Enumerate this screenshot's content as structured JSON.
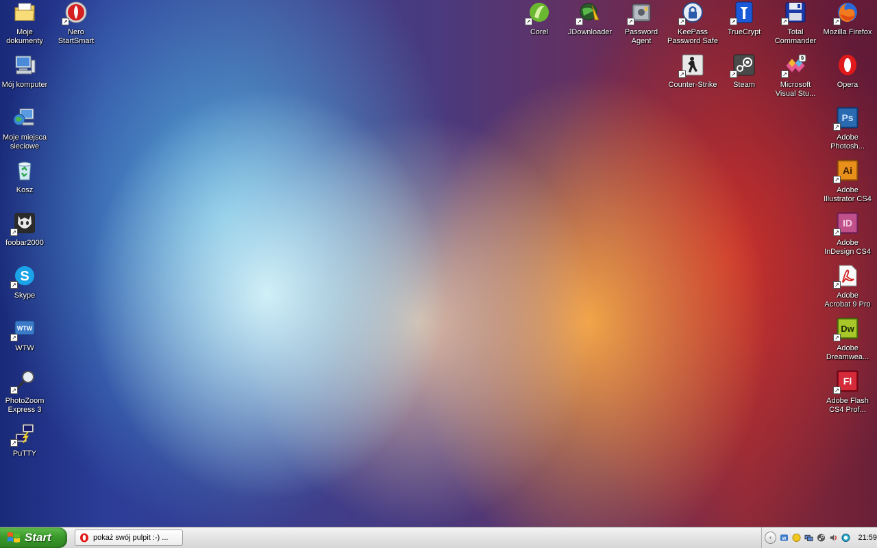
{
  "desktop": {
    "icons": [
      {
        "label": "Moje\ndokumenty",
        "icon": "documents-folder-icon"
      },
      {
        "label": "Nero\nStartSmart",
        "icon": "nero-icon"
      },
      {
        "label": "Mój komputer",
        "icon": "computer-icon"
      },
      {
        "label": "Moje miejsca\nsieciowe",
        "icon": "network-places-icon"
      },
      {
        "label": "Kosz",
        "icon": "recycle-bin-icon"
      },
      {
        "label": "foobar2000",
        "icon": "foobar2000-icon"
      },
      {
        "label": "Skype",
        "icon": "skype-icon"
      },
      {
        "label": "WTW",
        "icon": "wtw-icon"
      },
      {
        "label": "PhotoZoom\nExpress 3",
        "icon": "photozoom-icon"
      },
      {
        "label": "PuTTY",
        "icon": "putty-icon"
      },
      {
        "label": "Corel",
        "icon": "corel-icon"
      },
      {
        "label": "JDownloader",
        "icon": "jdownloader-icon"
      },
      {
        "label": "Password\nAgent",
        "icon": "password-agent-icon"
      },
      {
        "label": "KeePass\nPassword Safe",
        "icon": "keepass-icon"
      },
      {
        "label": "TrueCrypt",
        "icon": "truecrypt-icon"
      },
      {
        "label": "Total\nCommander",
        "icon": "total-commander-icon"
      },
      {
        "label": "Mozilla Firefox",
        "icon": "firefox-icon"
      },
      {
        "label": "Counter-Strike",
        "icon": "counter-strike-icon"
      },
      {
        "label": "Steam",
        "icon": "steam-icon"
      },
      {
        "label": "Microsoft\nVisual Stu...",
        "icon": "visual-studio-icon"
      },
      {
        "label": "Opera",
        "icon": "opera-icon"
      },
      {
        "label": "Adobe\nPhotosh...",
        "icon": "photoshop-icon"
      },
      {
        "label": "Adobe\nIllustrator CS4",
        "icon": "illustrator-icon"
      },
      {
        "label": "Adobe\nInDesign CS4",
        "icon": "indesign-icon"
      },
      {
        "label": "Adobe\nAcrobat 9 Pro",
        "icon": "acrobat-icon"
      },
      {
        "label": "Adobe\nDreamwea...",
        "icon": "dreamweaver-icon"
      },
      {
        "label": "Adobe Flash\nCS4 Prof...",
        "icon": "flash-icon"
      }
    ],
    "icon_texts": {
      "photoshop": "Ps",
      "illustrator": "Ai",
      "indesign": "ID",
      "dreamweaver": "Dw",
      "flash": "Fl",
      "wtw": "WTW",
      "visual_studio_badge": "9"
    }
  },
  "taskbar": {
    "start_label": "Start",
    "tasks": [
      {
        "label": "pokaż swój pulpit :-) ...",
        "icon": "opera-icon"
      }
    ],
    "tray": {
      "icons": [
        "tray-chevron-icon",
        "wtw-tray-icon",
        "messenger-tray-icon",
        "network-tray-icon",
        "steam-tray-icon",
        "volume-tray-icon",
        "update-tray-icon"
      ],
      "clock": "21:59"
    }
  },
  "colors": {
    "start_green": "#3b9a2c",
    "taskbar_grey": "#e6e6e6",
    "desktop_blue": "#2c3d98",
    "desktop_orange": "#f8aa46",
    "desktop_red": "#d73228"
  }
}
